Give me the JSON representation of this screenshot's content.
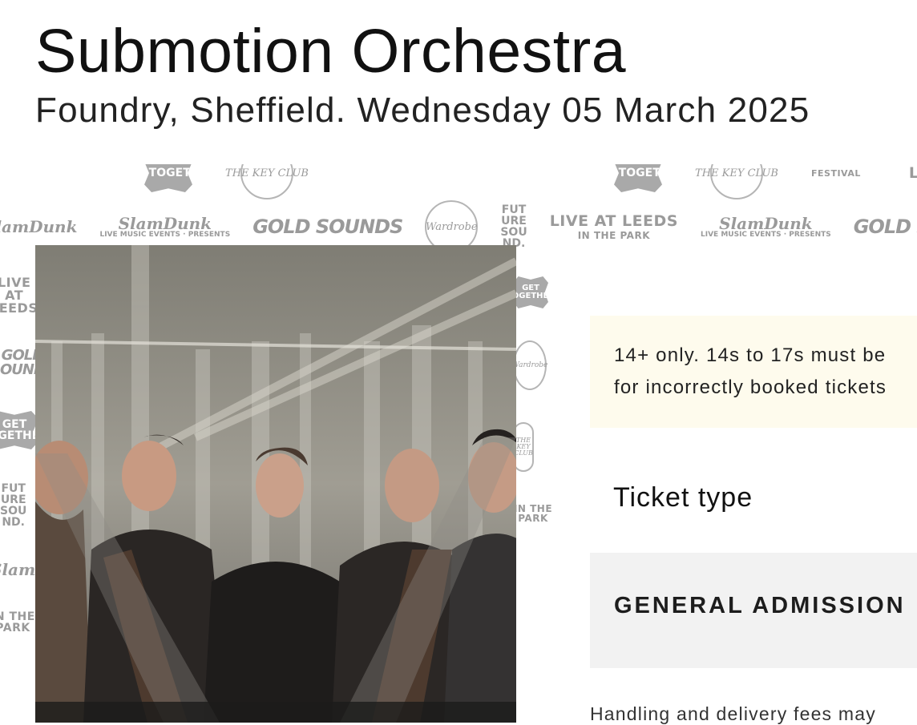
{
  "event": {
    "title": "Submotion Orchestra",
    "subtitle": "Foundry, Sheffield. Wednesday 05 March 2025"
  },
  "logos": {
    "slam_dunk": "SlamDunk",
    "slam_presents": "LIVE MUSIC EVENTS · PRESENTS",
    "gold_sounds": "GOLD SOUNDS",
    "wardrobe": "Wardrobe",
    "future_sound": [
      "FUT",
      "URE",
      "SOU",
      "ND."
    ],
    "live_at_leeds": "LIVE AT LEEDS",
    "in_the_park": "IN THE PARK",
    "get_together": "GET TOGETHER",
    "festival": "FESTIVAL",
    "the_key_club": "THE KEY CLUB"
  },
  "notice": {
    "line1": "14+ only. 14s to 17s must be",
    "line2": "for incorrectly booked tickets"
  },
  "tickets": {
    "heading": "Ticket type",
    "type_name": "GENERAL ADMISSION"
  },
  "fees_note": "Handling and delivery fees may",
  "colors": {
    "notice_bg": "#fefbed",
    "ticket_bg": "#f2f2f2",
    "logo_gray": "#9a9a9a"
  }
}
